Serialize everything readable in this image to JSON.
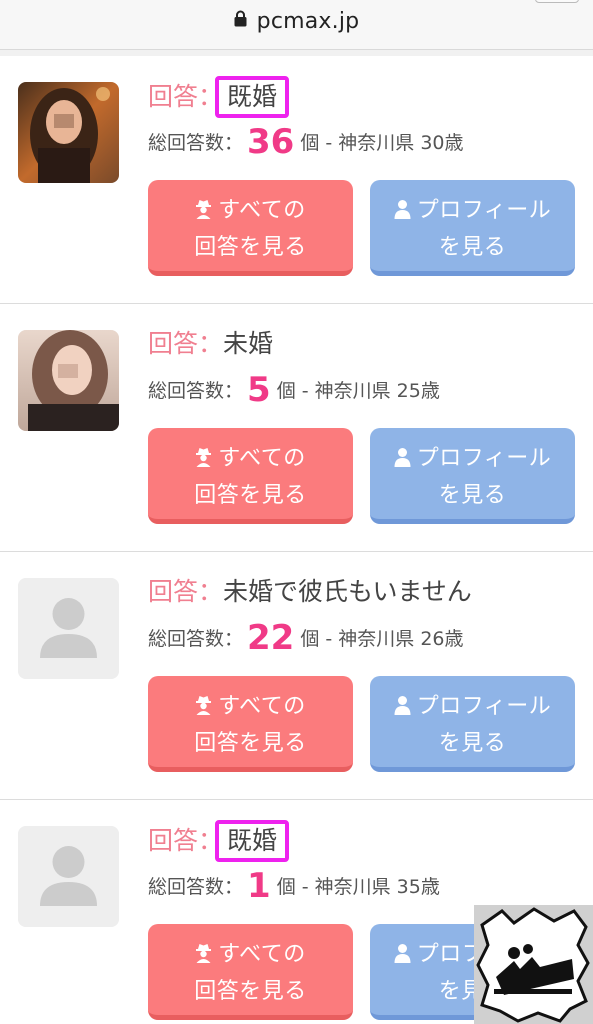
{
  "browser": {
    "url": "pcmax.jp"
  },
  "labels": {
    "answer_prefix": "回答：",
    "total_prefix": "総回答数：",
    "count_unit": "個",
    "all_answers_line1": "すべての",
    "all_answers_line2": "回答を見る",
    "profile_line1": "プロフィール",
    "profile_line2": "を見る"
  },
  "answers": [
    {
      "answer": "既婚",
      "highlighted": true,
      "total": "36",
      "meta": "- 神奈川県 30歳",
      "avatar": "photo"
    },
    {
      "answer": "未婚",
      "highlighted": false,
      "total": "5",
      "meta": "- 神奈川県 25歳",
      "avatar": "photo"
    },
    {
      "answer": "未婚で彼氏もいません",
      "highlighted": false,
      "total": "22",
      "meta": "- 神奈川県 26歳",
      "avatar": "placeholder"
    },
    {
      "answer": "既婚",
      "highlighted": true,
      "total": "1",
      "meta": "- 神奈川県 35歳",
      "avatar": "placeholder"
    }
  ],
  "colors": {
    "accent_pink": "#f03a87",
    "highlight_box": "#ee22ee",
    "button_red": "#fb7b7d",
    "button_blue": "#8fb4e7"
  },
  "icons": [
    "lock-icon",
    "user-silhouette-icon",
    "spy-icon",
    "person-icon",
    "watermark-logo-icon"
  ]
}
